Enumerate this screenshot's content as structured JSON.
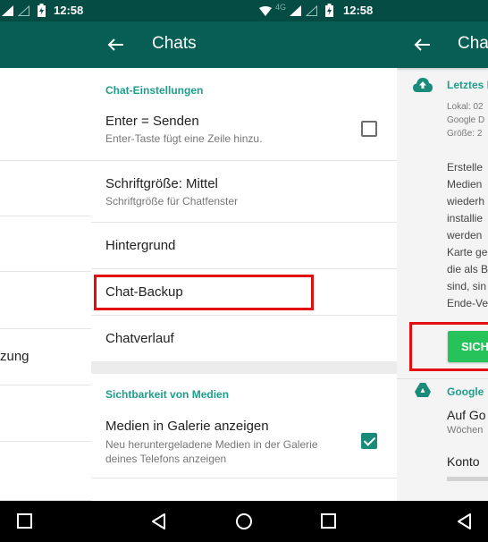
{
  "status_bar": {
    "time": "12:58",
    "network_label": "4G"
  },
  "left_panel": {
    "partial_item_text": "zung"
  },
  "mid_panel": {
    "appbar": {
      "title": "Chats",
      "back_icon": "arrow-left-icon"
    },
    "sections": [
      {
        "header": "Chat-Einstellungen",
        "items": [
          {
            "title": "Enter = Senden",
            "subtitle": "Enter-Taste fügt eine Zeile hinzu.",
            "control": "checkbox",
            "checked": false
          },
          {
            "title": "Schriftgröße: Mittel",
            "subtitle": "Schriftgröße für Chatfenster"
          },
          {
            "title": "Hintergrund"
          },
          {
            "title": "Chat-Backup",
            "highlighted": true
          },
          {
            "title": "Chatverlauf"
          }
        ]
      },
      {
        "header": "Sichtbarkeit von Medien",
        "items": [
          {
            "title": "Medien in Galerie anzeigen",
            "subtitle_line1": "Neu heruntergeladene Medien in der Galerie",
            "subtitle_line2": "deines Telefons anzeigen",
            "control": "checkbox",
            "checked": true
          }
        ]
      }
    ]
  },
  "right_panel": {
    "appbar": {
      "title": "Chats",
      "back_icon": "arrow-left-icon"
    },
    "backup_section": {
      "icon": "cloud-upload-icon",
      "header": "Letztes Backup",
      "lines": [
        "Lokal: 02",
        "Google D",
        "Größe: 2"
      ],
      "description_lines": [
        "Erstelle",
        "Medien",
        "wiederh",
        "installie",
        "werden",
        "Karte ge",
        "die als B",
        "sind, sin",
        "Ende-Ve"
      ],
      "button_label": "SICHERN"
    },
    "drive_section": {
      "icon": "google-drive-icon",
      "header": "Google",
      "item1_title": "Auf Go",
      "item1_sub": "Wöchen",
      "item2_title": "Konto"
    },
    "accent_color": "#1d9e8b",
    "button_color": "#25c35a"
  },
  "nav_bar": {
    "buttons": [
      "back-icon",
      "home-icon",
      "recents-icon"
    ]
  },
  "colors": {
    "appbar": "#075e54",
    "statusbar": "#054d44",
    "highlight": "#e20f0f"
  }
}
